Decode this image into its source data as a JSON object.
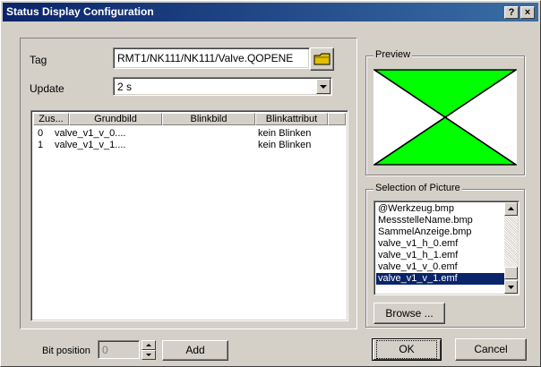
{
  "window": {
    "title": "Status Display Configuration",
    "help_label": "?",
    "close_label": "×"
  },
  "tag": {
    "label": "Tag",
    "value": "RMT1/NK111/NK111/Valve.QOPENE",
    "browse_icon": "folder-icon"
  },
  "update": {
    "label": "Update",
    "value": "2 s"
  },
  "table": {
    "headers": [
      "Zus...",
      "Grundbild",
      "Blinkbild",
      "Blinkattribut"
    ],
    "rows": [
      [
        "0",
        "valve_v1_v_0....",
        "",
        "kein Blinken"
      ],
      [
        "1",
        "valve_v1_v_1....",
        "",
        "kein Blinken"
      ]
    ]
  },
  "preview": {
    "title": "Preview",
    "fill_color": "#00ff00"
  },
  "selection": {
    "title": "Selection of Picture",
    "items": [
      "@Werkzeug.bmp",
      "MessstelleName.bmp",
      "SammelAnzeige.bmp",
      "valve_v1_h_0.emf",
      "valve_v1_h_1.emf",
      "valve_v1_v_0.emf",
      "valve_v1_v_1.emf"
    ],
    "selected_index": 6,
    "browse_label": "Browse ..."
  },
  "bottom": {
    "bit_label": "Bit position",
    "bit_value": "0",
    "add_label": "Add",
    "ok_label": "OK",
    "cancel_label": "Cancel"
  }
}
